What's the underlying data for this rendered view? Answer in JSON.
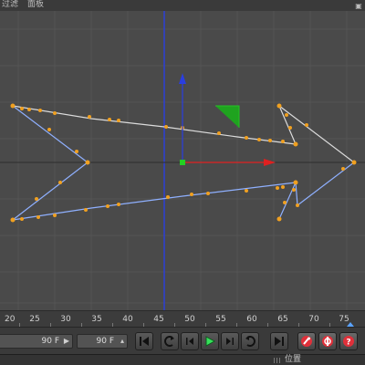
{
  "menubar": {
    "items": [
      "过滤",
      "面板"
    ]
  },
  "timeline": {
    "ticks": [
      "20",
      "25",
      "30",
      "35",
      "40",
      "45",
      "50",
      "55",
      "60",
      "65",
      "70",
      "75"
    ],
    "current_frame": 76
  },
  "controls": {
    "end_frame_left": "90 F",
    "end_frame_right": "90 F"
  },
  "bottom_panel": {
    "label": "位置"
  },
  "colors": {
    "viewport_bg": "#4a4a4a",
    "spline_point": "#f0a020",
    "x_axis": "#e02020",
    "y_axis": "#2a3ee0",
    "z_axis": "#20a020",
    "grid": "#5a5a5a"
  },
  "icons": {
    "goto_start": "skip-to-start-icon",
    "prev_key": "previous-keyframe-icon",
    "prev_frame": "previous-frame-icon",
    "play": "play-icon",
    "next_frame": "next-frame-icon",
    "next_key": "next-keyframe-icon",
    "goto_end": "skip-to-end-icon",
    "record": "record-keys-icon",
    "auto_key": "auto-keying-icon",
    "help": "help-icon"
  }
}
